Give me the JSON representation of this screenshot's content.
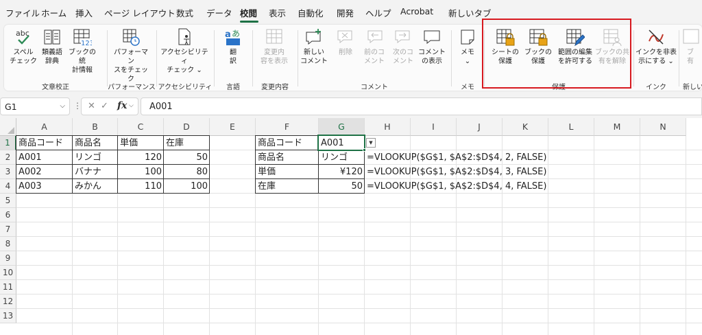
{
  "tabs": [
    {
      "label": "ファイル",
      "active": false
    },
    {
      "label": "ホーム",
      "active": false
    },
    {
      "label": "挿入",
      "active": false
    },
    {
      "label": "ページ レイアウト",
      "active": false
    },
    {
      "label": "数式",
      "active": false
    },
    {
      "label": "データ",
      "active": false
    },
    {
      "label": "校閲",
      "active": true
    },
    {
      "label": "表示",
      "active": false
    },
    {
      "label": "自動化",
      "active": false
    },
    {
      "label": "開発",
      "active": false
    },
    {
      "label": "ヘルプ",
      "active": false
    },
    {
      "label": "Acrobat",
      "active": false
    },
    {
      "label": "新しいタブ",
      "active": false
    }
  ],
  "ribbon": {
    "buttons": [
      {
        "label": "スペル\nチェック",
        "icon": "spellcheck-icon",
        "disabled": false
      },
      {
        "label": "類義語\n辞典",
        "icon": "thesaurus-icon",
        "disabled": false
      },
      {
        "label": "ブックの統\n計情報",
        "icon": "workbook-statistics-icon",
        "disabled": false
      },
      {
        "label": "パフォーマン\nスをチェック",
        "icon": "performance-check-icon",
        "disabled": false
      },
      {
        "label": "アクセシビリティ\nチェック ⌄",
        "icon": "accessibility-icon",
        "disabled": false
      },
      {
        "label": "翻\n訳",
        "icon": "translate-icon",
        "disabled": false
      },
      {
        "label": "変更内\n容を表示",
        "icon": "show-changes-icon",
        "disabled": true
      },
      {
        "label": "新しい\nコメント",
        "icon": "new-comment-icon",
        "disabled": false
      },
      {
        "label": "削除",
        "icon": "delete-comment-icon",
        "disabled": true
      },
      {
        "label": "前のコ\nメント",
        "icon": "previous-comment-icon",
        "disabled": true
      },
      {
        "label": "次のコ\nメント",
        "icon": "next-comment-icon",
        "disabled": true
      },
      {
        "label": "コメント\nの表示",
        "icon": "show-comments-icon",
        "disabled": false
      },
      {
        "label": "メモ\n⌄",
        "icon": "notes-icon",
        "disabled": false
      },
      {
        "label": "シートの\n保護",
        "icon": "protect-sheet-icon",
        "disabled": false
      },
      {
        "label": "ブックの\n保護",
        "icon": "protect-workbook-icon",
        "disabled": false
      },
      {
        "label": "範囲の編集\nを許可する",
        "icon": "allow-edit-ranges-icon",
        "disabled": false
      },
      {
        "label": "ブックの共\n有を解除",
        "icon": "unshare-workbook-icon",
        "disabled": true
      },
      {
        "label": "インクを非表\n示にする ⌄",
        "icon": "hide-ink-icon",
        "disabled": false
      },
      {
        "label": "ブ\n有",
        "icon": "partial-icon",
        "disabled": true
      }
    ],
    "groups": [
      "文章校正",
      "パフォーマンス",
      "アクセシビリティ",
      "言語",
      "変更内容",
      "コメント",
      "メモ",
      "保護",
      "インク",
      "新しいグ"
    ]
  },
  "formula_bar": {
    "name_box": "G1",
    "formula": "A001",
    "fx_label": "fx"
  },
  "columns": [
    "A",
    "B",
    "C",
    "D",
    "E",
    "F",
    "G",
    "H",
    "I",
    "J",
    "K",
    "L",
    "M",
    "N"
  ],
  "rows": [
    "1",
    "2",
    "3",
    "4",
    "5",
    "6",
    "7",
    "8",
    "9",
    "10",
    "11",
    "12",
    "13"
  ],
  "table": {
    "headers": [
      "商品コード",
      "商品名",
      "単価",
      "在庫"
    ],
    "rows": [
      [
        "A001",
        "リンゴ",
        "120",
        "50"
      ],
      [
        "A002",
        "バナナ",
        "100",
        "80"
      ],
      [
        "A003",
        "みかん",
        "110",
        "100"
      ]
    ]
  },
  "lookup": {
    "labels": [
      "商品コード",
      "商品名",
      "単価",
      "在庫"
    ],
    "values": [
      "A001",
      "リンゴ",
      "¥120",
      "50"
    ],
    "formulas": [
      "=VLOOKUP($G$1, $A$2:$D$4, 2, FALSE)",
      "=VLOOKUP($G$1, $A$2:$D$4, 3, FALSE)",
      "=VLOOKUP($G$1, $A$2:$D$4, 4, FALSE)"
    ]
  },
  "colors": {
    "accent": "#1e7145",
    "highlight_box": "#d7191f",
    "disabled_text": "#a8a8a8"
  }
}
